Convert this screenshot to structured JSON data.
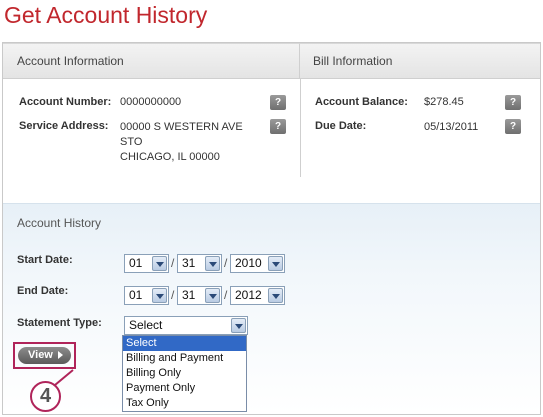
{
  "page": {
    "title": "Get Account History"
  },
  "account_info": {
    "header": "Account Information",
    "account_number_label": "Account Number:",
    "account_number": "0000000000",
    "service_address_label": "Service Address:",
    "address_line1": "00000 S WESTERN AVE",
    "address_line2": "STO",
    "address_line3": "CHICAGO, IL 00000",
    "help_glyph": "?"
  },
  "bill_info": {
    "header": "Bill Information",
    "balance_label": "Account Balance:",
    "balance": "$278.45",
    "due_label": "Due Date:",
    "due_date": "05/13/2011",
    "help_glyph": "?"
  },
  "history": {
    "header": "Account History",
    "start_label": "Start Date:",
    "end_label": "End Date:",
    "statement_label": "Statement Type:",
    "start": {
      "month": "01",
      "day": "31",
      "year": "2010"
    },
    "end": {
      "month": "01",
      "day": "31",
      "year": "2012"
    },
    "separator": "/",
    "statement_value": "Select",
    "statement_options": [
      "Select",
      "Billing and Payment",
      "Billing Only",
      "Payment Only",
      "Tax Only"
    ],
    "view_label": "View"
  },
  "callout": {
    "step": "4",
    "color": "#b0245a"
  },
  "colors": {
    "title": "#c1272d",
    "highlight": "#3169c6"
  }
}
